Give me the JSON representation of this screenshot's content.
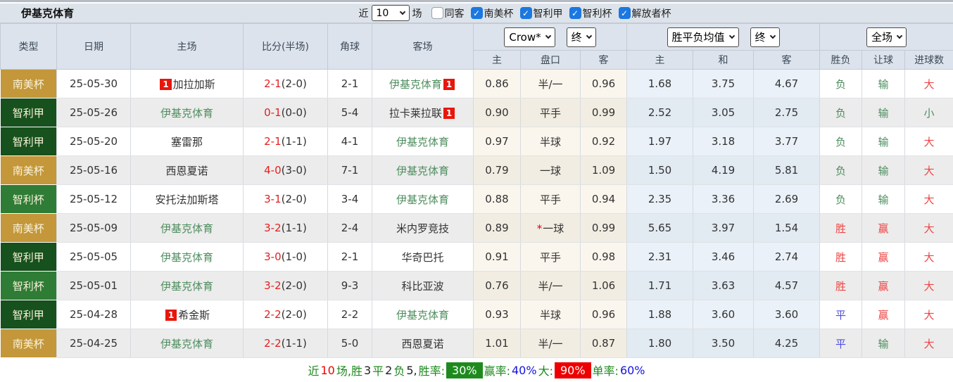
{
  "topbar": {
    "title": "伊基克体育",
    "recent_label": "近",
    "recent_value": "10",
    "matches_label": "场",
    "checkboxes": [
      {
        "label": "同客",
        "checked": false
      },
      {
        "label": "南美杯",
        "checked": true
      },
      {
        "label": "智利甲",
        "checked": true
      },
      {
        "label": "智利杯",
        "checked": true
      },
      {
        "label": "解放者杯",
        "checked": true
      }
    ]
  },
  "table": {
    "main_headers": [
      "类型",
      "日期",
      "主场",
      "比分(半场)",
      "角球",
      "客场"
    ],
    "dropdowns": {
      "ah_company": "Crow*",
      "ah_time": "终",
      "eu_company": "胜平负均值",
      "eu_time": "终",
      "scope": "全场"
    },
    "sub_headers": {
      "ah": [
        "主",
        "盘口",
        "客"
      ],
      "eu": [
        "主",
        "和",
        "客"
      ],
      "result": [
        "胜负",
        "让球",
        "进球数"
      ]
    },
    "league_colors": {
      "南美杯": "#c3973a",
      "智利甲": "#17511d",
      "智利杯": "#2e7c35"
    },
    "result_color_map": {
      "胜": "red",
      "平": "blue",
      "负": "green",
      "赢": "red",
      "输": "green",
      "大": "red",
      "小": "green"
    },
    "rows": [
      {
        "league": "南美杯",
        "date": "25-05-30",
        "home": {
          "name": "加拉加斯",
          "highlight": false,
          "badge": "1",
          "badge_pos": "before"
        },
        "score_ft": "2-1",
        "score_ht": "(2-0)",
        "corner": "2-1",
        "away": {
          "name": "伊基克体育",
          "highlight": true,
          "badge": "1",
          "badge_pos": "after"
        },
        "ah_home": "0.86",
        "ah_line": "半/一",
        "ah_star": false,
        "ah_away": "0.96",
        "eu_home": "1.68",
        "eu_draw": "3.75",
        "eu_away": "4.67",
        "res_wdl": "负",
        "res_handicap": "输",
        "res_goals": "大"
      },
      {
        "league": "智利甲",
        "date": "25-05-26",
        "home": {
          "name": "伊基克体育",
          "highlight": true
        },
        "score_ft": "0-1",
        "score_ht": "(0-0)",
        "corner": "5-4",
        "away": {
          "name": "拉卡莱拉联",
          "highlight": false,
          "badge": "1",
          "badge_pos": "after"
        },
        "ah_home": "0.90",
        "ah_line": "平手",
        "ah_star": false,
        "ah_away": "0.99",
        "eu_home": "2.52",
        "eu_draw": "3.05",
        "eu_away": "2.75",
        "res_wdl": "负",
        "res_handicap": "输",
        "res_goals": "小"
      },
      {
        "league": "智利甲",
        "date": "25-05-20",
        "home": {
          "name": "塞雷那",
          "highlight": false
        },
        "score_ft": "2-1",
        "score_ht": "(1-1)",
        "corner": "4-1",
        "away": {
          "name": "伊基克体育",
          "highlight": true
        },
        "ah_home": "0.97",
        "ah_line": "半球",
        "ah_star": false,
        "ah_away": "0.92",
        "eu_home": "1.97",
        "eu_draw": "3.18",
        "eu_away": "3.77",
        "res_wdl": "负",
        "res_handicap": "输",
        "res_goals": "大"
      },
      {
        "league": "南美杯",
        "date": "25-05-16",
        "home": {
          "name": "西恩夏诺",
          "highlight": false
        },
        "score_ft": "4-0",
        "score_ht": "(3-0)",
        "corner": "7-1",
        "away": {
          "name": "伊基克体育",
          "highlight": true
        },
        "ah_home": "0.79",
        "ah_line": "一球",
        "ah_star": false,
        "ah_away": "1.09",
        "eu_home": "1.50",
        "eu_draw": "4.19",
        "eu_away": "5.81",
        "res_wdl": "负",
        "res_handicap": "输",
        "res_goals": "大"
      },
      {
        "league": "智利杯",
        "date": "25-05-12",
        "home": {
          "name": "安托法加斯塔",
          "highlight": false
        },
        "score_ft": "3-1",
        "score_ht": "(2-0)",
        "corner": "3-4",
        "away": {
          "name": "伊基克体育",
          "highlight": true
        },
        "ah_home": "0.88",
        "ah_line": "平手",
        "ah_star": false,
        "ah_away": "0.94",
        "eu_home": "2.35",
        "eu_draw": "3.36",
        "eu_away": "2.69",
        "res_wdl": "负",
        "res_handicap": "输",
        "res_goals": "大"
      },
      {
        "league": "南美杯",
        "date": "25-05-09",
        "home": {
          "name": "伊基克体育",
          "highlight": true
        },
        "score_ft": "3-2",
        "score_ht": "(1-1)",
        "corner": "2-4",
        "away": {
          "name": "米内罗竞技",
          "highlight": false
        },
        "ah_home": "0.89",
        "ah_line": "一球",
        "ah_star": true,
        "ah_away": "0.99",
        "eu_home": "5.65",
        "eu_draw": "3.97",
        "eu_away": "1.54",
        "res_wdl": "胜",
        "res_handicap": "赢",
        "res_goals": "大"
      },
      {
        "league": "智利甲",
        "date": "25-05-05",
        "home": {
          "name": "伊基克体育",
          "highlight": true
        },
        "score_ft": "3-0",
        "score_ht": "(1-0)",
        "corner": "2-1",
        "away": {
          "name": "华奇巴托",
          "highlight": false
        },
        "ah_home": "0.91",
        "ah_line": "平手",
        "ah_star": false,
        "ah_away": "0.98",
        "eu_home": "2.31",
        "eu_draw": "3.46",
        "eu_away": "2.74",
        "res_wdl": "胜",
        "res_handicap": "赢",
        "res_goals": "大"
      },
      {
        "league": "智利杯",
        "date": "25-05-01",
        "home": {
          "name": "伊基克体育",
          "highlight": true
        },
        "score_ft": "3-2",
        "score_ht": "(2-0)",
        "corner": "9-3",
        "away": {
          "name": "科比亚波",
          "highlight": false
        },
        "ah_home": "0.76",
        "ah_line": "半/一",
        "ah_star": false,
        "ah_away": "1.06",
        "eu_home": "1.71",
        "eu_draw": "3.63",
        "eu_away": "4.57",
        "res_wdl": "胜",
        "res_handicap": "赢",
        "res_goals": "大"
      },
      {
        "league": "智利甲",
        "date": "25-04-28",
        "home": {
          "name": "希金斯",
          "highlight": false,
          "badge": "1",
          "badge_pos": "before"
        },
        "score_ft": "2-2",
        "score_ht": "(2-0)",
        "corner": "2-2",
        "away": {
          "name": "伊基克体育",
          "highlight": true
        },
        "ah_home": "0.93",
        "ah_line": "半球",
        "ah_star": false,
        "ah_away": "0.96",
        "eu_home": "1.88",
        "eu_draw": "3.60",
        "eu_away": "3.60",
        "res_wdl": "平",
        "res_handicap": "赢",
        "res_goals": "大"
      },
      {
        "league": "南美杯",
        "date": "25-04-25",
        "home": {
          "name": "伊基克体育",
          "highlight": true
        },
        "score_ft": "2-2",
        "score_ht": "(1-1)",
        "corner": "5-0",
        "away": {
          "name": "西恩夏诺",
          "highlight": false
        },
        "ah_home": "1.01",
        "ah_line": "半/一",
        "ah_star": false,
        "ah_away": "0.87",
        "eu_home": "1.80",
        "eu_draw": "3.50",
        "eu_away": "4.25",
        "res_wdl": "平",
        "res_handicap": "输",
        "res_goals": "大"
      }
    ]
  },
  "summary": {
    "parts": [
      {
        "text": "近",
        "style": "green"
      },
      {
        "text": "10",
        "style": "red"
      },
      {
        "text": "场,胜",
        "style": "green"
      },
      {
        "text": "3",
        "style": "dark"
      },
      {
        "text": "平",
        "style": "green"
      },
      {
        "text": "2",
        "style": "dark"
      },
      {
        "text": "负",
        "style": "green"
      },
      {
        "text": "5,",
        "style": "dark"
      },
      {
        "text": " 胜率:",
        "style": "green"
      },
      {
        "text": "30%",
        "style": "badge-green"
      },
      {
        "text": " 赢率:",
        "style": "green"
      },
      {
        "text": "40%",
        "style": "blue"
      },
      {
        "text": " 大:",
        "style": "green"
      },
      {
        "text": "90%",
        "style": "badge-red"
      },
      {
        "text": " 单率:",
        "style": "green"
      },
      {
        "text": "60%",
        "style": "blue"
      }
    ]
  }
}
